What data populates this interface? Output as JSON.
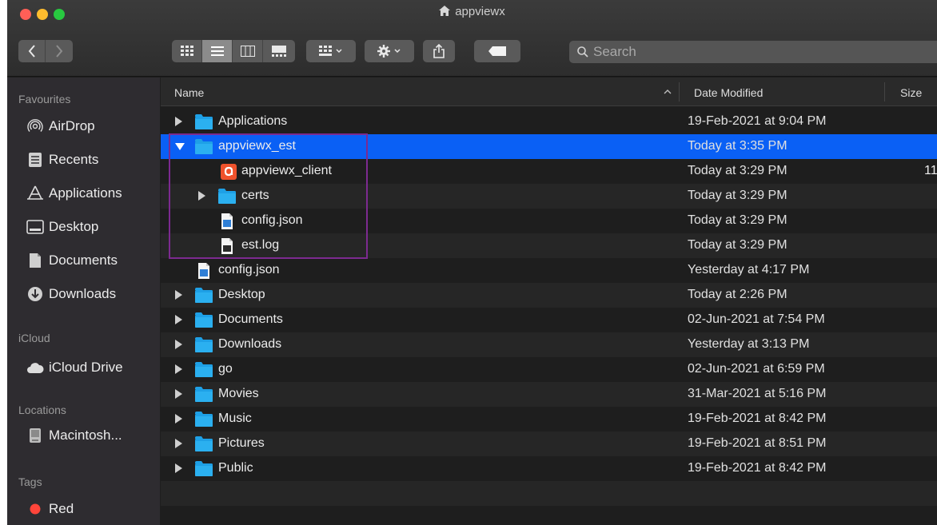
{
  "window": {
    "title": "appviewx"
  },
  "toolbar": {
    "back_icon": "chevron-left-icon",
    "forward_icon": "chevron-right-icon",
    "view_modes": [
      "icon-view",
      "list-view",
      "column-view",
      "gallery-view"
    ],
    "active_view": "list-view",
    "search_placeholder": "Search"
  },
  "sidebar": {
    "sections": [
      {
        "header": "Favourites",
        "items": [
          {
            "label": "AirDrop",
            "icon": "airdrop-icon"
          },
          {
            "label": "Recents",
            "icon": "recents-icon"
          },
          {
            "label": "Applications",
            "icon": "applications-icon"
          },
          {
            "label": "Desktop",
            "icon": "desktop-icon"
          },
          {
            "label": "Documents",
            "icon": "documents-icon"
          },
          {
            "label": "Downloads",
            "icon": "downloads-icon"
          }
        ]
      },
      {
        "header": "iCloud",
        "items": [
          {
            "label": "iCloud Drive",
            "icon": "cloud-icon"
          }
        ]
      },
      {
        "header": "Locations",
        "items": [
          {
            "label": "Macintosh...",
            "icon": "disk-icon"
          }
        ]
      },
      {
        "header": "Tags",
        "items": [
          {
            "label": "Red",
            "icon": "red-tag-icon",
            "color": "#ff453a"
          }
        ]
      }
    ]
  },
  "columns": {
    "name": "Name",
    "date": "Date Modified",
    "size": "Size"
  },
  "files": [
    {
      "name": "Applications",
      "date": "19-Feb-2021 at 9:04 PM",
      "size": "",
      "kind": "folder",
      "level": 0,
      "disclosure": "closed"
    },
    {
      "name": "appviewx_est",
      "date": "Today at 3:35 PM",
      "size": "",
      "kind": "folder",
      "level": 0,
      "disclosure": "open",
      "selected": true
    },
    {
      "name": "appviewx_client",
      "date": "Today at 3:29 PM",
      "size": "11",
      "kind": "executable",
      "level": 1,
      "disclosure": "none"
    },
    {
      "name": "certs",
      "date": "Today at 3:29 PM",
      "size": "",
      "kind": "folder",
      "level": 1,
      "disclosure": "closed"
    },
    {
      "name": "config.json",
      "date": "Today at 3:29 PM",
      "size": "",
      "kind": "document",
      "level": 1,
      "disclosure": "none"
    },
    {
      "name": "est.log",
      "date": "Today at 3:29 PM",
      "size": "",
      "kind": "log",
      "level": 1,
      "disclosure": "none"
    },
    {
      "name": "config.json",
      "date": "Yesterday at 4:17 PM",
      "size": "",
      "kind": "document",
      "level": 0,
      "disclosure": "none"
    },
    {
      "name": "Desktop",
      "date": "Today at 2:26 PM",
      "size": "",
      "kind": "folder",
      "level": 0,
      "disclosure": "closed"
    },
    {
      "name": "Documents",
      "date": "02-Jun-2021 at 7:54 PM",
      "size": "",
      "kind": "folder",
      "level": 0,
      "disclosure": "closed"
    },
    {
      "name": "Downloads",
      "date": "Yesterday at 3:13 PM",
      "size": "",
      "kind": "folder",
      "level": 0,
      "disclosure": "closed"
    },
    {
      "name": "go",
      "date": "02-Jun-2021 at 6:59 PM",
      "size": "",
      "kind": "folder",
      "level": 0,
      "disclosure": "closed"
    },
    {
      "name": "Movies",
      "date": "31-Mar-2021 at 5:16 PM",
      "size": "",
      "kind": "folder",
      "level": 0,
      "disclosure": "closed"
    },
    {
      "name": "Music",
      "date": "19-Feb-2021 at 8:42 PM",
      "size": "",
      "kind": "folder",
      "level": 0,
      "disclosure": "closed"
    },
    {
      "name": "Pictures",
      "date": "19-Feb-2021 at 8:51 PM",
      "size": "",
      "kind": "folder",
      "level": 0,
      "disclosure": "closed"
    },
    {
      "name": "Public",
      "date": "19-Feb-2021 at 8:42 PM",
      "size": "",
      "kind": "folder",
      "level": 0,
      "disclosure": "closed"
    }
  ],
  "colors": {
    "selection": "#0a60f5",
    "folder": "#1ea0e6",
    "highlight_box": "#7c2a90"
  }
}
